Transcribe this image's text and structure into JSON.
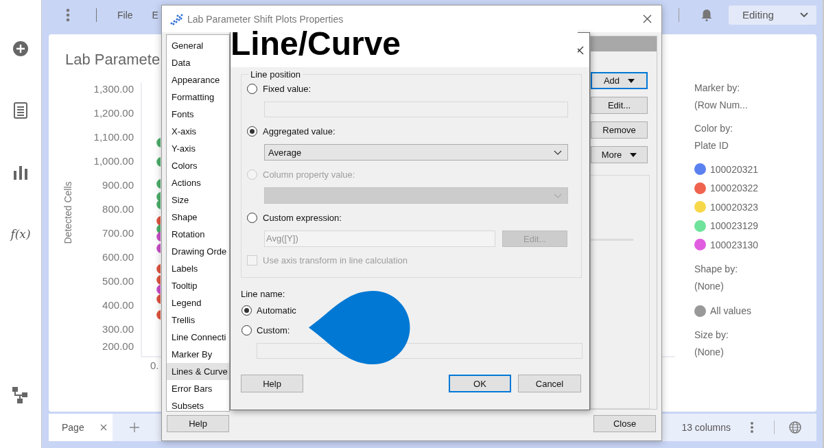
{
  "app": {
    "toolbar": {
      "menu": [
        "File",
        "E"
      ],
      "mode": "Editing"
    },
    "rail": {
      "function_label": "f(x)"
    },
    "page_tabs": [
      {
        "label": "Page",
        "selected": true
      }
    ],
    "status": "13 columns"
  },
  "chart": {
    "title": "Lab Paramete",
    "ylabel": "Detected Cells",
    "yticks": [
      "1,300.00",
      "1,200.00",
      "1,100.00",
      "1,000.00",
      "900.00",
      "800.00",
      "700.00",
      "600.00",
      "500.00",
      "400.00",
      "300.00",
      "200.00"
    ],
    "xtick": "0."
  },
  "legend": {
    "sections": [
      {
        "heading": "Marker by:",
        "value": "(Row Num..."
      },
      {
        "heading": "Color by:",
        "value": "Plate ID",
        "items": [
          {
            "label": "100020321",
            "color": "#5b80f0"
          },
          {
            "label": "100020322",
            "color": "#f0644f"
          },
          {
            "label": "100020323",
            "color": "#f7d84a"
          },
          {
            "label": "100023129",
            "color": "#6fe39b"
          },
          {
            "label": "100023130",
            "color": "#e05de0"
          }
        ]
      },
      {
        "heading": "Shape by:",
        "value": "(None)",
        "items": [
          {
            "label": "All values",
            "color": "#999999"
          }
        ]
      },
      {
        "heading": "Size by:",
        "value": "(None)"
      }
    ]
  },
  "outer_dialog": {
    "title": "Lab Parameter Shift Plots Properties",
    "nav": [
      {
        "label": "General",
        "selected": false
      },
      {
        "label": "Data",
        "selected": false
      },
      {
        "label": "Appearance",
        "selected": false
      },
      {
        "label": "Formatting",
        "selected": false
      },
      {
        "label": "Fonts",
        "selected": false
      },
      {
        "label": "X-axis",
        "selected": false
      },
      {
        "label": "Y-axis",
        "selected": false
      },
      {
        "label": "Colors",
        "selected": false
      },
      {
        "label": "Actions",
        "selected": false
      },
      {
        "label": "Size",
        "selected": false
      },
      {
        "label": "Shape",
        "selected": false
      },
      {
        "label": "Rotation",
        "selected": false
      },
      {
        "label": "Drawing Orde",
        "selected": false
      },
      {
        "label": "Labels",
        "selected": false
      },
      {
        "label": "Tooltip",
        "selected": false
      },
      {
        "label": "Legend",
        "selected": false
      },
      {
        "label": "Trellis",
        "selected": false
      },
      {
        "label": "Line Connecti",
        "selected": false
      },
      {
        "label": "Marker By",
        "selected": false
      },
      {
        "label": "Lines & Curve",
        "selected": true
      },
      {
        "label": "Error Bars",
        "selected": false
      },
      {
        "label": "Subsets",
        "selected": false
      }
    ],
    "actions": [
      {
        "label": "Add",
        "menu": true,
        "focused": true
      },
      {
        "label": "Edit...",
        "menu": false,
        "focused": false
      },
      {
        "label": "Remove",
        "menu": false,
        "focused": false
      },
      {
        "label": "More",
        "menu": true,
        "focused": false
      }
    ],
    "help": "Help",
    "close": "Close"
  },
  "line_dialog": {
    "overlay_title": "Line/Curve",
    "position_group": {
      "title": "Line position",
      "options": [
        {
          "label": "Fixed value:",
          "selected": false,
          "disabled": false,
          "control": {
            "kind": "field"
          }
        },
        {
          "label": "Aggregated value:",
          "selected": true,
          "disabled": false,
          "control": {
            "kind": "dropdown",
            "value": "Average",
            "disabled": false
          }
        },
        {
          "label": "Column property value:",
          "selected": false,
          "disabled": true,
          "control": {
            "kind": "dropdown",
            "disabled": true
          }
        },
        {
          "label": "Custom expression:",
          "selected": false,
          "disabled": false,
          "control": {
            "kind": "expression",
            "value": "Avg([Y])",
            "button": "Edit...",
            "disabled": true
          }
        }
      ],
      "axis_transform": {
        "label": "Use axis transform in line calculation",
        "checked": false,
        "disabled": true
      }
    },
    "name_group": {
      "title": "Line name:",
      "options": [
        {
          "label": "Automatic",
          "selected": true
        },
        {
          "label": "Custom:",
          "selected": false
        }
      ]
    },
    "buttons": {
      "help": "Help",
      "ok": "OK",
      "cancel": "Cancel"
    }
  }
}
